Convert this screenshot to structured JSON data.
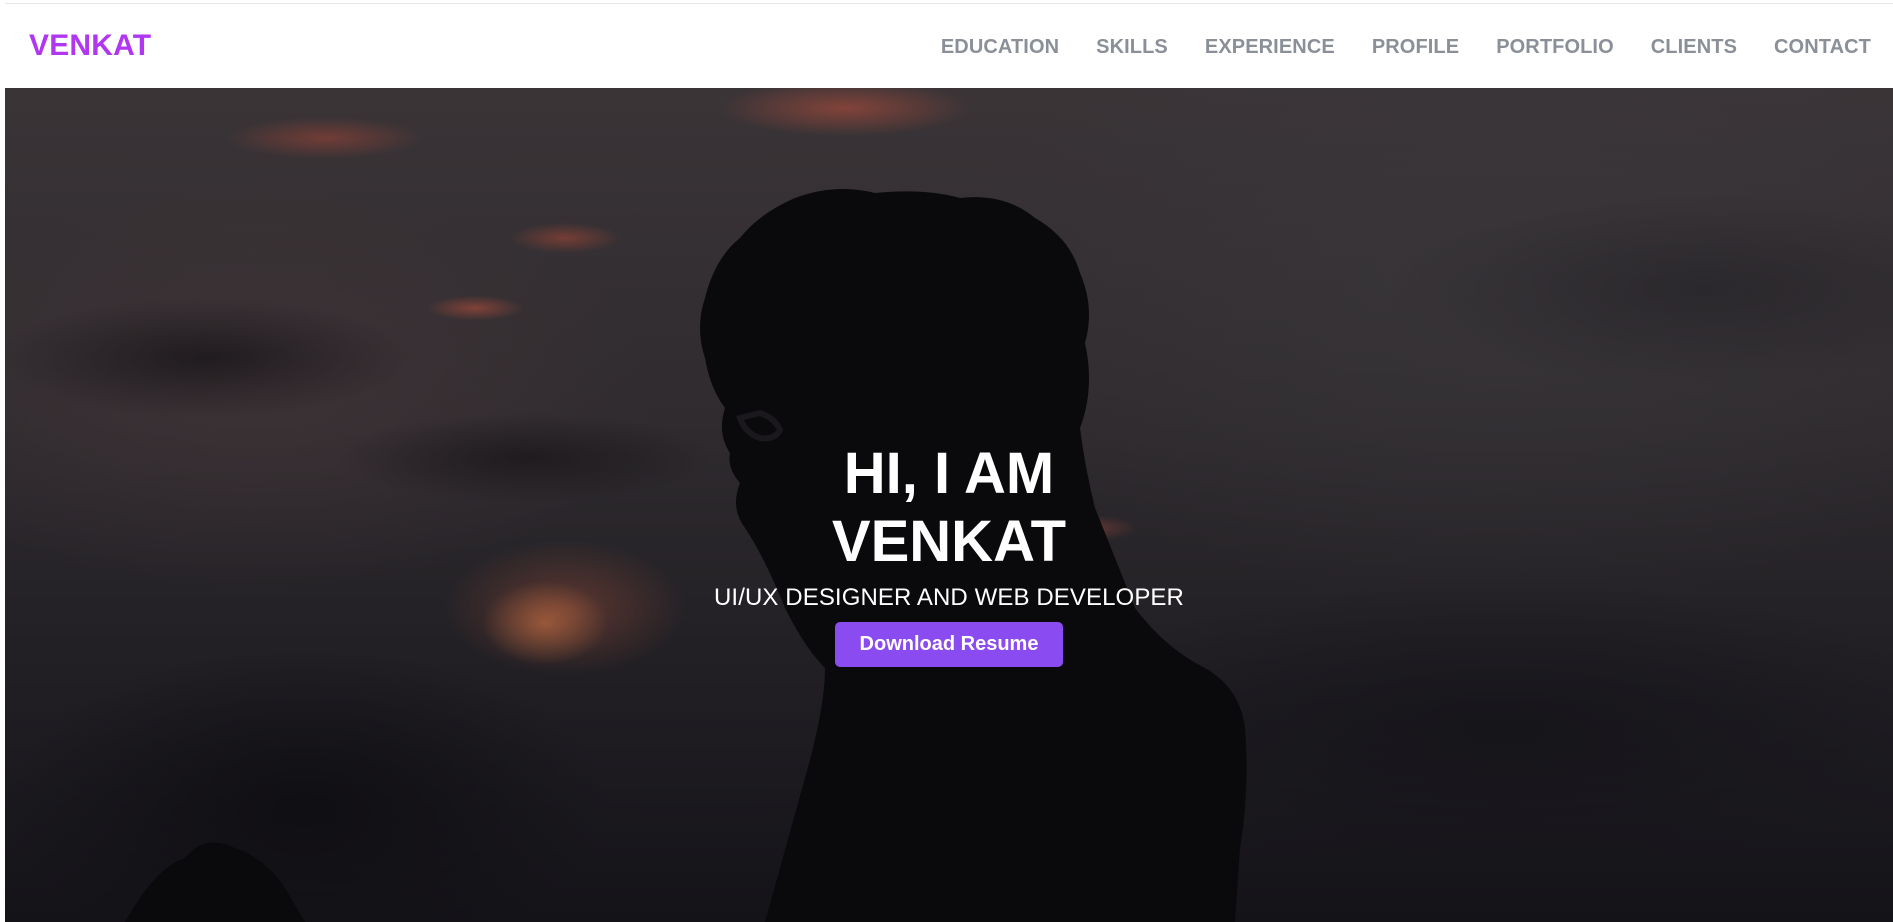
{
  "navbar": {
    "brand": "VENKAT",
    "links": [
      "EDUCATION",
      "SKILLS",
      "EXPERIENCE",
      "PROFILE",
      "PORTFOLIO",
      "CLIENTS",
      "CONTACT"
    ]
  },
  "hero": {
    "title_line1": "HI, I AM",
    "title_line2": "VENKAT",
    "subtitle": "UI/UX DESIGNER AND WEB DEVELOPER",
    "button_label": "Download Resume"
  },
  "colors": {
    "brand": "#b136f0",
    "nav_text": "#8a8f98",
    "button_bg": "#8a4cf0"
  }
}
